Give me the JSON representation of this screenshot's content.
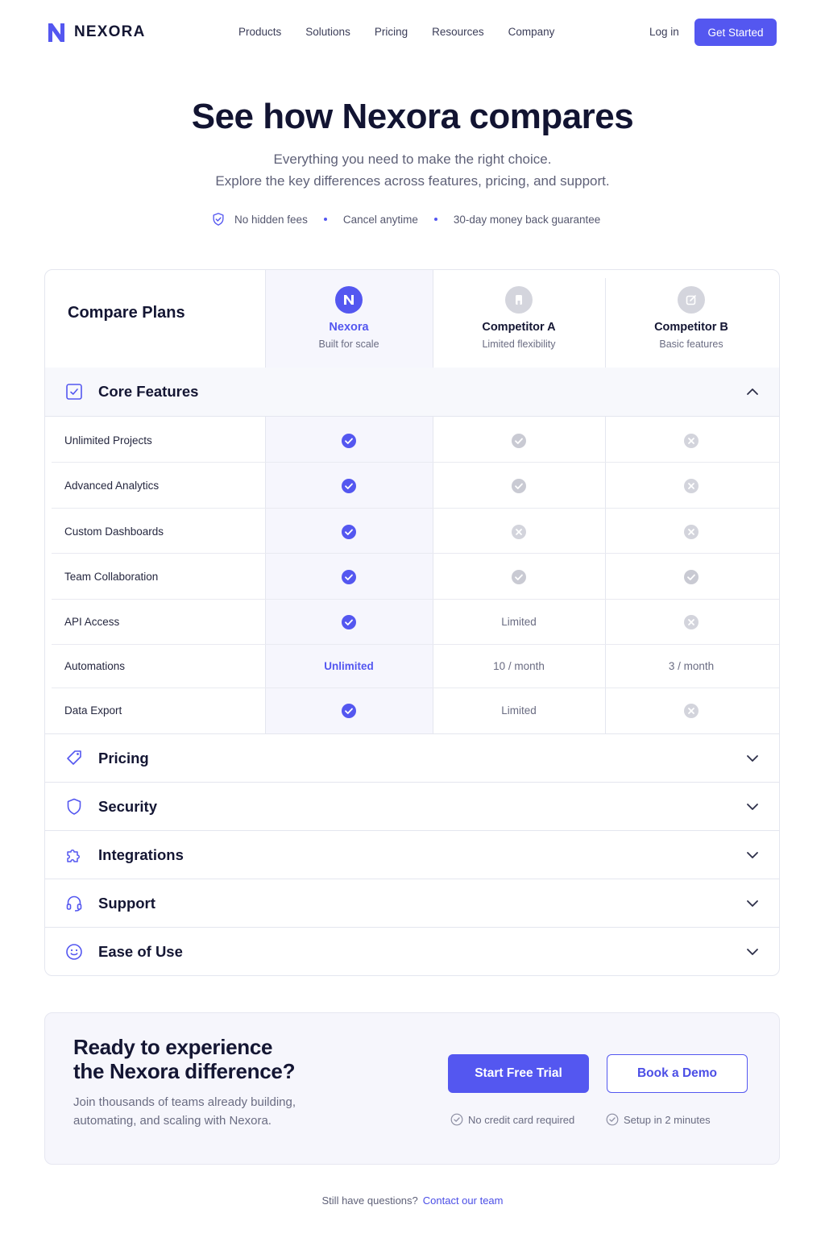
{
  "brand": {
    "name": "NEXORA",
    "accent": "#5457f0"
  },
  "nav": {
    "links": [
      "Products",
      "Solutions",
      "Pricing",
      "Resources",
      "Company"
    ],
    "login": "Log in",
    "cta": "Get Started"
  },
  "hero": {
    "title": "See how Nexora compares",
    "subtitle_line1": "Everything you need to make the right choice.",
    "subtitle_line2": "Explore the key differences across features, pricing, and support.",
    "trust": [
      "No hidden fees",
      "Cancel anytime",
      "30-day money back guarantee"
    ]
  },
  "table": {
    "title": "Compare Plans",
    "plans": [
      {
        "name": "Nexora",
        "tagline": "Built for scale"
      },
      {
        "name": "Competitor A",
        "tagline": "Limited flexibility"
      },
      {
        "name": "Competitor B",
        "tagline": "Basic features"
      }
    ],
    "core_section": "Core Features",
    "rows": [
      {
        "label": "Unlimited Projects",
        "values": [
          "check",
          "check",
          "cross"
        ]
      },
      {
        "label": "Advanced Analytics",
        "values": [
          "check",
          "check",
          "cross"
        ]
      },
      {
        "label": "Custom Dashboards",
        "values": [
          "check",
          "cross",
          "cross"
        ]
      },
      {
        "label": "Team Collaboration",
        "values": [
          "check",
          "check",
          "check"
        ]
      },
      {
        "label": "API Access",
        "values": [
          "check",
          "Limited",
          "cross"
        ]
      },
      {
        "label": "Automations",
        "values": [
          "Unlimited",
          "10 / month",
          "3 / month"
        ]
      },
      {
        "label": "Data Export",
        "values": [
          "check",
          "Limited",
          "cross"
        ]
      }
    ],
    "collapsed_sections": [
      "Pricing",
      "Security",
      "Integrations",
      "Support",
      "Ease of Use"
    ]
  },
  "cta": {
    "title_line1": "Ready to experience",
    "title_line2": "the Nexora difference?",
    "text_line1": "Join thousands of teams already building,",
    "text_line2": "automating, and scaling with Nexora.",
    "primary": "Start Free Trial",
    "secondary": "Book a Demo",
    "notes": [
      "No credit card required",
      "Setup in 2 minutes"
    ]
  },
  "footer": {
    "question": "Still have questions?",
    "link": "Contact our team"
  }
}
